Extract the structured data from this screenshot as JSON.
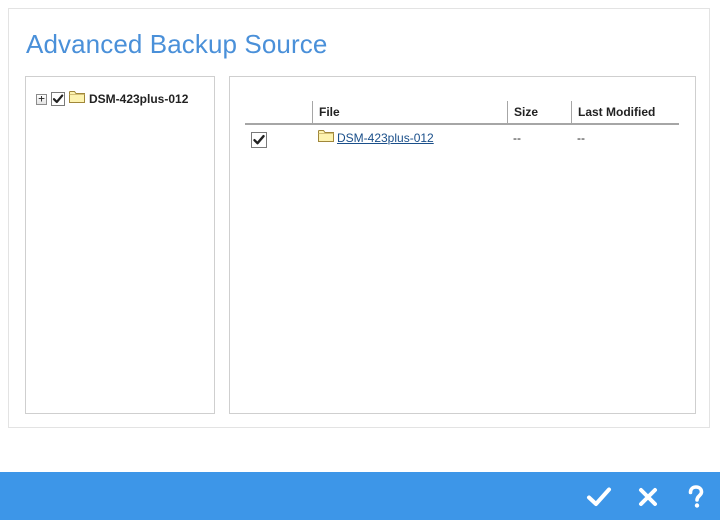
{
  "dialog": {
    "title": "Advanced Backup Source"
  },
  "tree": {
    "root": {
      "label": "DSM-423plus-012",
      "checked": true,
      "expander": "+",
      "icon": "folder-icon"
    }
  },
  "grid": {
    "columns": {
      "file": "File",
      "size": "Size",
      "last_modified": "Last Modified"
    },
    "rows": [
      {
        "checked": true,
        "file": "DSM-423plus-012",
        "size": "--",
        "last_modified": "--"
      }
    ]
  },
  "footer": {
    "confirm_icon": "checkmark-icon",
    "cancel_icon": "close-icon",
    "help_icon": "help-icon"
  },
  "colors": {
    "title": "#4a90d9",
    "footer": "#3d96e8",
    "link": "#1a4f8a",
    "folder_fill": "#fdf3b0",
    "folder_stroke": "#a0873a"
  }
}
